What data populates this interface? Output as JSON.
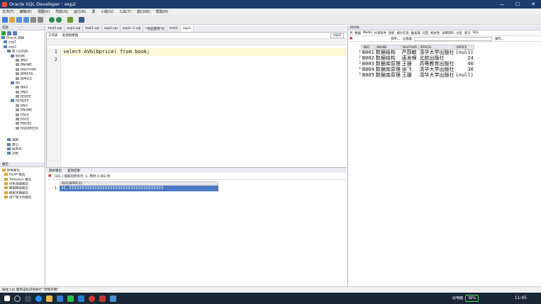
{
  "window": {
    "title": "Oracle SQL Developer : exp2",
    "minimize": "—",
    "maximize": "☐",
    "close": "✕"
  },
  "menu": [
    "文件(F)",
    "编辑(E)",
    "视图(V)",
    "导航(N)",
    "运行(R)",
    "源",
    "小组(G)",
    "工具(T)",
    "窗口(W)",
    "帮助(H)"
  ],
  "left": {
    "connections_header": "连接",
    "tree": [
      "Oracle 连接",
      "exp1",
      "exp2",
      "表 (已过滤)",
      "BOOK",
      "BNO",
      "BNAME",
      "BAUTHOR",
      "BPRESS",
      "BPRICE",
      "BR",
      "BNO",
      "RNO",
      "RDATE",
      "READER",
      "RNO",
      "RNAME",
      "RSEX",
      "RAGE",
      "RBOSS",
      "RADDRESS",
      "视图",
      "索引",
      "程序包",
      "过程"
    ],
    "reports_header": "报告",
    "reports": [
      "所有报告",
      "OLAP 报告",
      "Timesten 报告",
      "分析视图报告",
      "数据模型报告",
      "数据字典报告",
      "用户定义的报告"
    ]
  },
  "file_tabs": [
    "test1.sql",
    "exp1.sql",
    "test1.sql",
    "exp2.sql",
    "exp2~1.sql",
    "*欢迎使用*页",
    "test1",
    "exp2"
  ],
  "editor": {
    "subtabs": [
      "工作表",
      "查询构建器"
    ],
    "lines": [
      "select AVG(bprice) from book;",
      ""
    ],
    "line_numbers": [
      "1",
      "2"
    ],
    "connection": "exp2"
  },
  "bottom_tabs": [
    "脚本输出",
    "查询结果"
  ],
  "results": {
    "status": "SQL | 提取的所有行: 1, 用时 0.003 秒",
    "column": "AVG(BPRICE)",
    "row_num": "1",
    "value": "31.3333333333333333333333333333333333333"
  },
  "right": {
    "tab": "BOOK",
    "subtabs": [
      "列",
      "数据",
      "Model",
      "约束条件",
      "授权",
      "统计信息",
      "触发器",
      "闪回",
      "相关性",
      "详细资料",
      "分区",
      "索引",
      "SQL"
    ],
    "actions_label": "操作...",
    "filter_label": "过滤器:",
    "sort_label": "排序...",
    "columns": [
      "BNO",
      "BNAME",
      "BAUTHOR",
      "BPRESS",
      "BPRICE"
    ],
    "rows": [
      [
        "1",
        "B001",
        "数据结构",
        "严蔚敏",
        "清华大学出版社",
        "(null)"
      ],
      [
        "2",
        "B002",
        "数据结构",
        "唐发根",
        "北航出版社",
        "24"
      ],
      [
        "3",
        "B003",
        "数据库原理",
        "王珊",
        "高等教育出版社",
        "40"
      ],
      [
        "4",
        "B004",
        "数据库原理",
        "张飞",
        "清华大学出版社",
        "30"
      ],
      [
        "5",
        "B005",
        "数据库原理",
        "王珊",
        "清华大学出版社",
        "(null)"
      ]
    ]
  },
  "status_bar": "按住 Ctrl 键单击标识符执行 \"转到声明\"",
  "taskbar": {
    "battery": "39%",
    "clock": "11:45",
    "computer": "此电脑"
  }
}
